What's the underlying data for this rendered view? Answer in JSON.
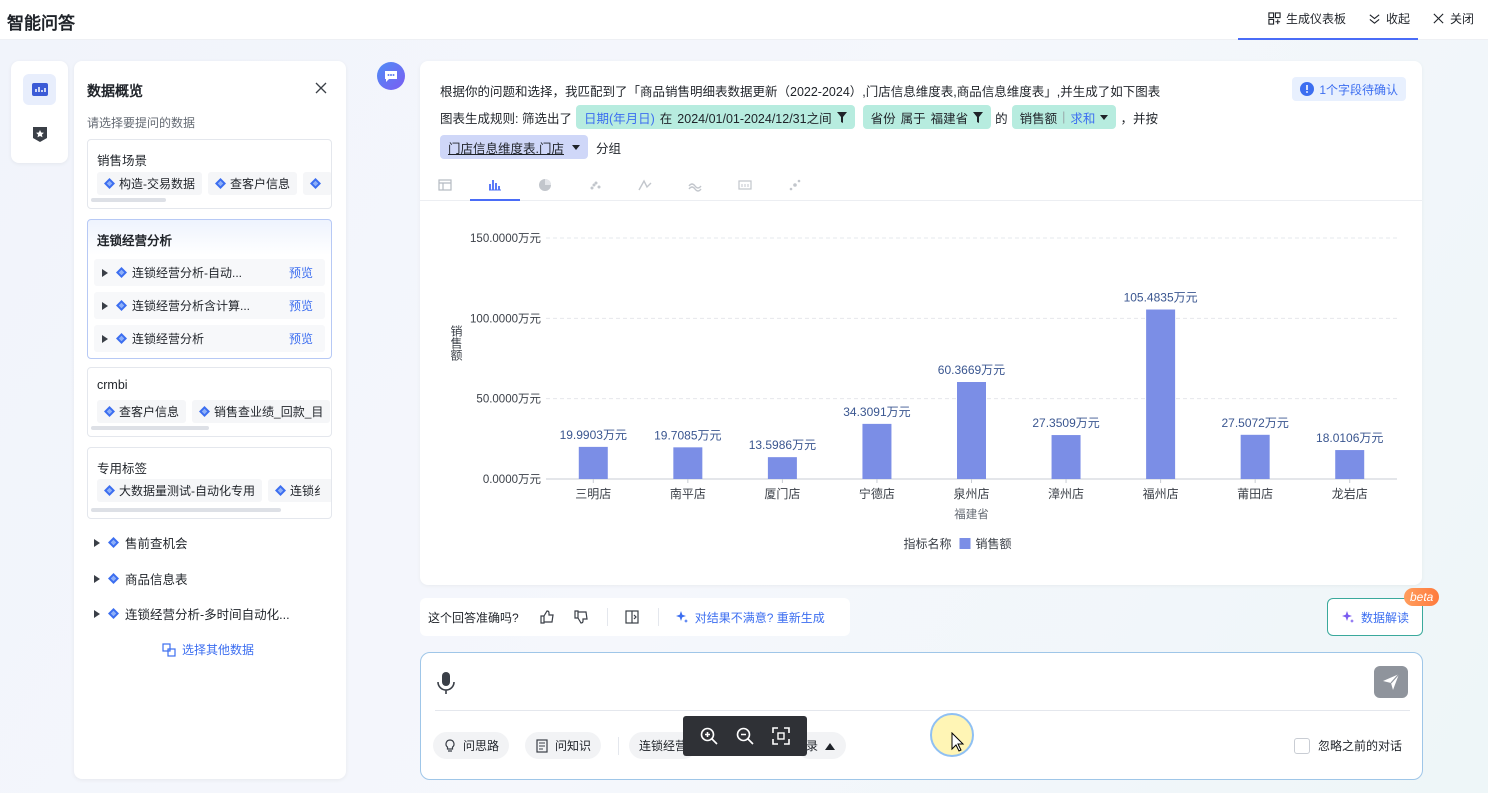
{
  "app": {
    "title": "智能问答"
  },
  "top_actions": [
    {
      "label": "生成仪表板",
      "icon": "dashboard-icon"
    },
    {
      "label": "收起",
      "icon": "collapse-icon"
    },
    {
      "label": "关闭",
      "icon": "close-icon"
    }
  ],
  "sidebar": {
    "title": "数据概览",
    "subtitle": "请选择要提问的数据",
    "groups": [
      {
        "name": "销售场景",
        "chips": [
          "构造-交易数据",
          "查客户信息",
          ""
        ]
      },
      {
        "name": "连锁经营分析",
        "rows": [
          {
            "label": "连锁经营分析-自动...",
            "preview": "预览"
          },
          {
            "label": "连锁经营分析含计算...",
            "preview": "预览"
          },
          {
            "label": "连锁经营分析",
            "preview": "预览"
          }
        ]
      },
      {
        "name": "crmbi",
        "chips": [
          "查客户信息",
          "销售查业绩_回款_目"
        ]
      },
      {
        "name": "专用标签",
        "chips": [
          "大数据量测试-自动化专用",
          "连锁纟"
        ]
      }
    ],
    "loose_items": [
      "售前查机会",
      "商品信息表",
      "连锁经营分析-多时间自动化..."
    ],
    "select_more": "选择其他数据"
  },
  "answer": {
    "match_text": "根据你的问题和选择，我匹配到了「商品销售明细表数据更新（2022-2024）,门店信息维度表,商品信息维度表」,并生成了如下图表",
    "pending_label": "1个字段待确认",
    "rule_prefix": "图表生成规则: 筛选出了",
    "filter1": {
      "field": "日期(年月日)",
      "op": "在",
      "value": "2024/01/01-2024/12/31之间"
    },
    "filter2": {
      "field": "省份",
      "op": "属于",
      "value": "福建省"
    },
    "connector_of": "的",
    "measure": {
      "field": "销售额",
      "agg": "求和"
    },
    "suffix_and": "，并按",
    "group_field": "门店信息维度表.门店",
    "group_suffix": "分组"
  },
  "chart_tabs": [
    "table-icon",
    "bar-chart-icon",
    "pie-chart-icon",
    "scatter-icon",
    "line-icon",
    "area-icon",
    "number-icon",
    "bubble-icon"
  ],
  "chart_data": {
    "type": "bar",
    "categories": [
      "三明店",
      "南平店",
      "厦门店",
      "宁德店",
      "泉州店",
      "漳州店",
      "福州店",
      "莆田店",
      "龙岩店"
    ],
    "series": [
      {
        "name": "销售额",
        "values": [
          19.9903,
          19.7085,
          13.5986,
          34.3091,
          60.3669,
          27.3509,
          105.4835,
          27.5072,
          18.0106
        ]
      }
    ],
    "data_labels": [
      "19.9903万元",
      "19.7085万元",
      "13.5986万元",
      "34.3091万元",
      "60.3669万元",
      "27.3509万元",
      "105.4835万元",
      "27.5072万元",
      "18.0106万元"
    ],
    "y_ticks": [
      0,
      50,
      100,
      150
    ],
    "y_tick_labels": [
      "0.0000万元",
      "50.0000万元",
      "100.0000万元",
      "150.0000万元"
    ],
    "ylim": [
      0,
      150
    ],
    "ylabel": "销售额",
    "xgroup_label": "福建省",
    "legend_title": "指标名称",
    "legend_placement": "bottom-center",
    "grid": true,
    "bar_color": "#7b8ee6"
  },
  "feedback": {
    "question": "这个回答准确吗?",
    "regen": "对结果不满意? 重新生成"
  },
  "interpret": {
    "label": "数据解读",
    "badge": "beta"
  },
  "input": {
    "pills": [
      "问思路",
      "问知识",
      "连锁经营",
      "录"
    ],
    "ignore_label": "忽略之前的对话"
  }
}
